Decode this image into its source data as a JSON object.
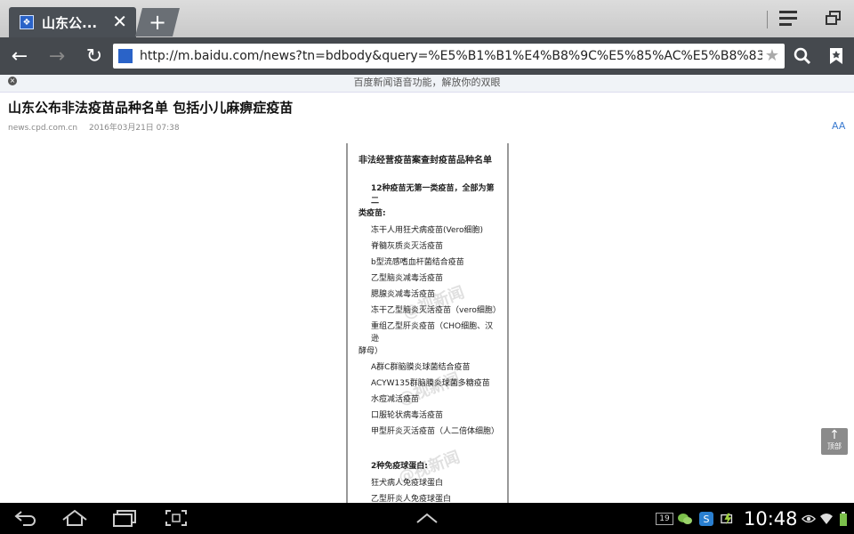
{
  "browser": {
    "tab": {
      "title": "山东公...",
      "favicon": "baidu-favicon-icon",
      "close": "✕"
    },
    "new_tab": "+",
    "address": "http://m.baidu.com/news?tn=bdbody&query=%E5%B1%B1%E4%B8%9C%E5%85%AC%E5%B8%83%E9%9D%9E%E6%B3",
    "icons": {
      "back": "←",
      "forward": "→",
      "reload": "↻",
      "search": "🔍",
      "bookmark": "★"
    }
  },
  "notice": {
    "text": "百度新闻语音功能，解放你的双眼",
    "close": "×"
  },
  "article": {
    "headline": "山东公布非法疫苗品种名单 包括小儿麻痹症疫苗",
    "source": "news.cpd.com.cn",
    "time": "2016年03月21日 07:38",
    "font_size_label": "AA",
    "image": {
      "title": "非法经营疫苗案查封疫苗品种名单",
      "section1": "12种疫苗无第一类疫苗，全部为第二",
      "section1_cont": "类疫苗:",
      "items1": [
        "冻干人用狂犬病疫苗(Vero细胞)",
        "脊髓灰质炎灭活疫苗",
        "b型流感嗜血杆菌结合疫苗",
        "乙型脑炎减毒活疫苗",
        "腮腺炎减毒活疫苗",
        "冻干乙型脑炎灭活疫苗（vero细胞）",
        "重组乙型肝炎疫苗（CHO细胞、汉逊",
        "酵母）",
        "A群C群脑膜炎球菌结合疫苗",
        "ACYW135群脑膜炎球菌多糖疫苗",
        "水痘减活疫苗",
        "口服轮状病毒活疫苗",
        "甲型肝炎灭活疫苗（人二倍体细胞）"
      ],
      "section2": "2种免疫球蛋白:",
      "items2": [
        "狂犬病人免疫球蛋白",
        "乙型肝炎人免疫球蛋白"
      ],
      "watermark": "@视新闻"
    },
    "top_button": {
      "arrow": "↑",
      "label": "顶部"
    }
  },
  "system_bar": {
    "clock": "10:48",
    "notification_count": "19",
    "icons": [
      "back-icon",
      "home-icon",
      "recents-icon",
      "screenshot-icon",
      "up-chevron-icon",
      "wechat-icon",
      "app-s-icon",
      "battery-charge-icon",
      "eye-icon",
      "wifi-icon",
      "battery-icon"
    ]
  }
}
